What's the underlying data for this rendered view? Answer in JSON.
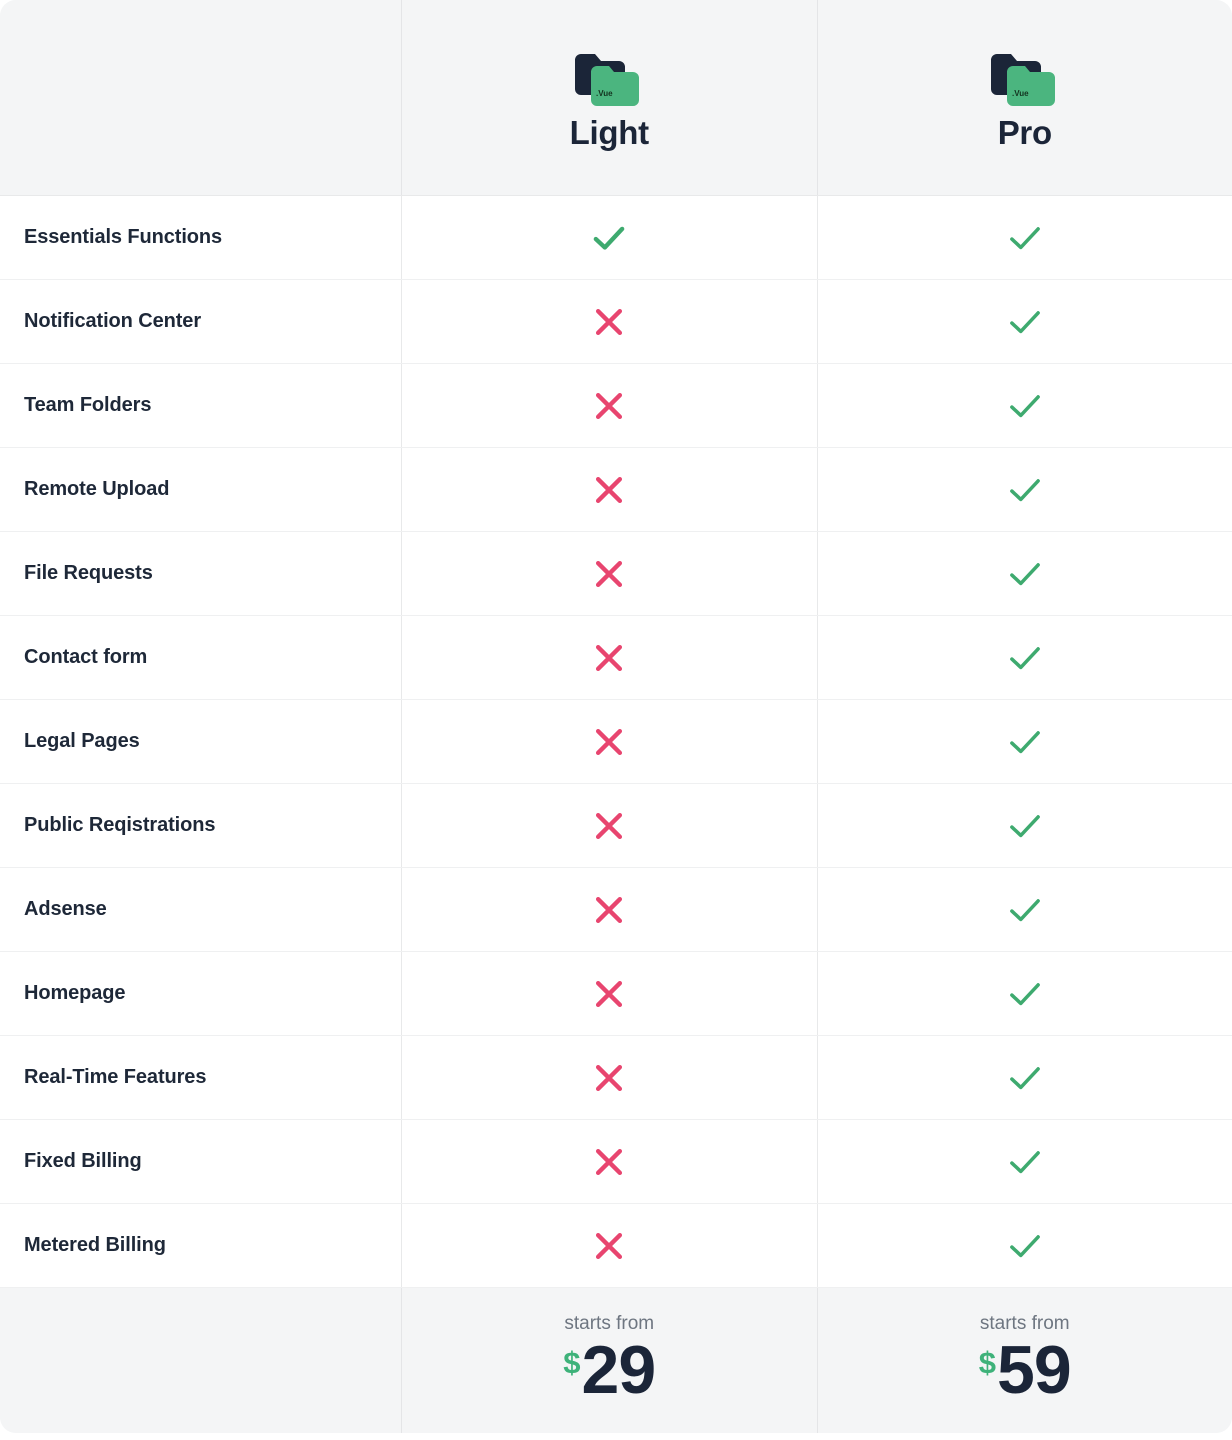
{
  "table": {
    "feature_column_header": "",
    "plans": [
      {
        "name": "Light",
        "icon": "vue-folder-icon",
        "icon_label": ".Vue",
        "starts_from_label": "starts from",
        "currency": "$",
        "price": "29"
      },
      {
        "name": "Pro",
        "icon": "vue-folder-icon",
        "icon_label": ".Vue",
        "starts_from_label": "starts from",
        "currency": "$",
        "price": "59"
      }
    ],
    "rows": [
      {
        "feature": "Essentials Functions",
        "light": "check",
        "pro": "check"
      },
      {
        "feature": "Notification Center",
        "light": "cross",
        "pro": "check"
      },
      {
        "feature": "Team Folders",
        "light": "cross",
        "pro": "check"
      },
      {
        "feature": "Remote Upload",
        "light": "cross",
        "pro": "check"
      },
      {
        "feature": "File Requests",
        "light": "cross",
        "pro": "check"
      },
      {
        "feature": "Contact form",
        "light": "cross",
        "pro": "check"
      },
      {
        "feature": "Legal Pages",
        "light": "cross",
        "pro": "check"
      },
      {
        "feature": "Public Reqistrations",
        "light": "cross",
        "pro": "check"
      },
      {
        "feature": "Adsense",
        "light": "cross",
        "pro": "check"
      },
      {
        "feature": "Homepage",
        "light": "cross",
        "pro": "check"
      },
      {
        "feature": "Real-Time Features",
        "light": "cross",
        "pro": "check"
      },
      {
        "feature": "Fixed Billing",
        "light": "cross",
        "pro": "check"
      },
      {
        "feature": "Metered Billing",
        "light": "cross",
        "pro": "check"
      }
    ]
  },
  "colors": {
    "check": "#3eaa6f",
    "cross": "#e8456f",
    "text_dark": "#1b2538",
    "text_muted": "#6e7681",
    "header_bg": "#f4f5f6",
    "border": "#e8e9ea",
    "folder_back": "#1b2538",
    "folder_front": "#4bb57f",
    "currency_green": "#3eb27a"
  }
}
